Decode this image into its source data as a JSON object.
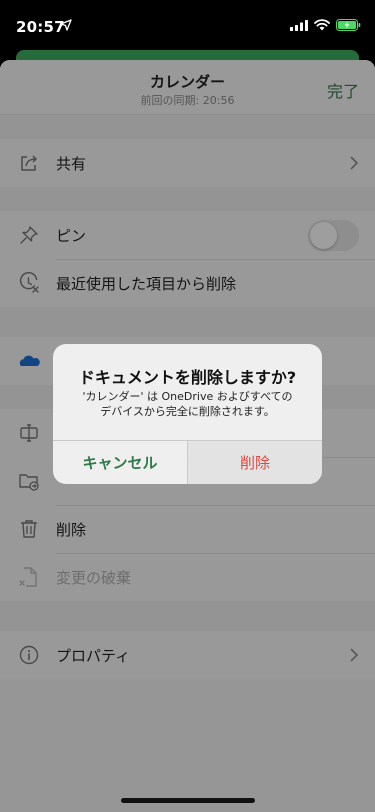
{
  "status_bar": {
    "time": "20:57"
  },
  "sheet": {
    "title": "カレンダー",
    "subtitle": "前回の同期: 20:56",
    "done_label": "完了"
  },
  "menu": {
    "share": "共有",
    "pin": "ピン",
    "pin_enabled": false,
    "remove_recent": "最近使用した項目から削除",
    "delete": "削除",
    "discard_changes": "変更の破棄",
    "properties": "プロパティ"
  },
  "alert": {
    "title": "ドキュメントを削除しますか?",
    "message": "'カレンダー' は OneDrive およびすべての\nデバイスから完全に削除されます。",
    "cancel_label": "キャンセル",
    "delete_label": "削除"
  },
  "colors": {
    "accent_green": "#2f7a48",
    "destructive_red": "#e0473f"
  }
}
